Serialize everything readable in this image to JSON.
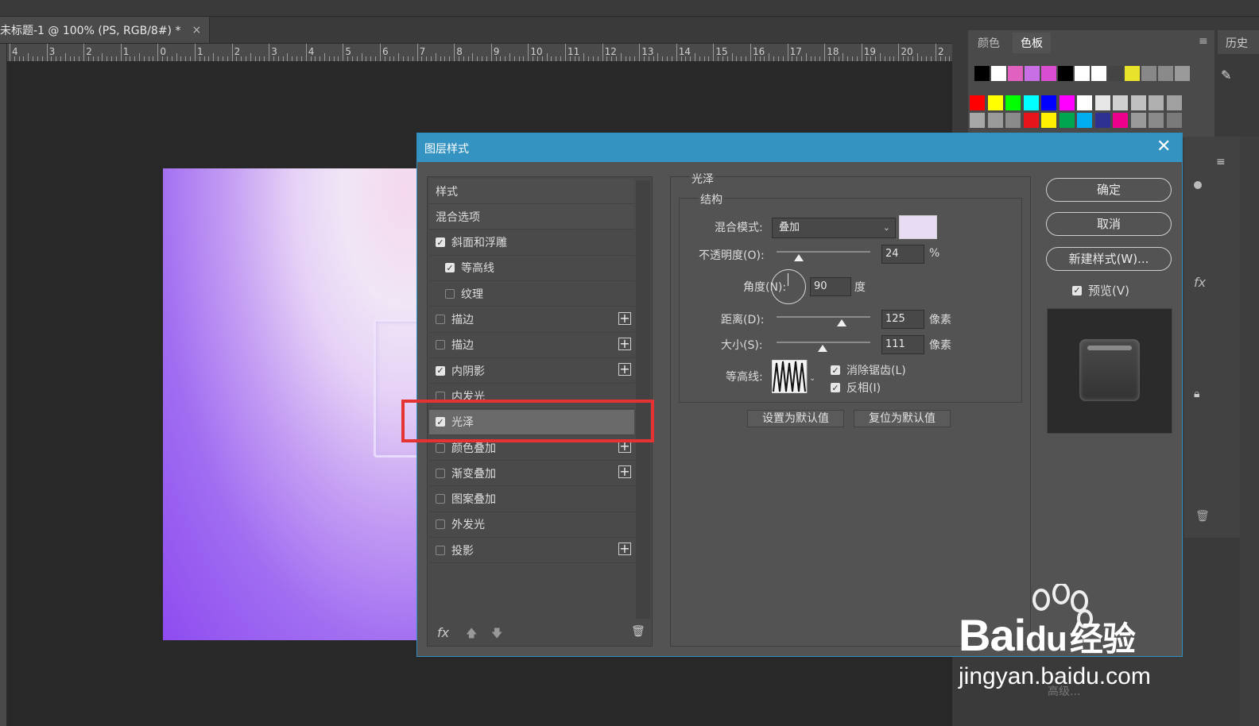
{
  "document": {
    "tab_title": "未标题-1 @ 100% (PS, RGB/8#) *",
    "close_glyph": "×"
  },
  "ruler": {
    "labels": [
      "4",
      "3",
      "2",
      "1",
      "0",
      "1",
      "2",
      "3",
      "4",
      "5",
      "6",
      "7",
      "8",
      "9",
      "10",
      "11",
      "12",
      "13",
      "14",
      "15",
      "16",
      "17",
      "18",
      "19",
      "20",
      "2"
    ]
  },
  "swatches_panel": {
    "tabs": [
      "颜色",
      "色板"
    ],
    "history_tab": "历史",
    "row1": [
      "#000000",
      "#ffffff",
      "#e061c0",
      "#c86fe6",
      "#d94ed1",
      "#000000",
      "#ffffff",
      "#ffffff",
      "#444444",
      "#e8e22a",
      "#888888",
      "#8a8a8a",
      "#9a9a9a"
    ],
    "row2": [
      "#ff0000",
      "#ffff00",
      "#00ff00",
      "#00ffff",
      "#0000ff",
      "#ff00ff",
      "#ffffff",
      "#e6e6e6",
      "#d0d0d0",
      "#c0c0c0",
      "#b0b0b0",
      "#a0a0a0"
    ],
    "row3": [
      "#a7a7a7",
      "#9a9a9a",
      "#8a8a8a",
      "#e8141b",
      "#fff100",
      "#00a650",
      "#00aeef",
      "#2e3192",
      "#ec008c",
      "#9a9a9a",
      "#8a8a8a",
      "#7a7a7a"
    ]
  },
  "dialog": {
    "title": "图层样式",
    "close_glyph": "✕",
    "style_list": [
      {
        "label": "样式",
        "header": true
      },
      {
        "label": "混合选项",
        "header": true
      },
      {
        "label": "斜面和浮雕",
        "checked": true
      },
      {
        "label": "等高线",
        "checked": true,
        "indent": true
      },
      {
        "label": "纹理",
        "checked": false,
        "indent": true
      },
      {
        "label": "描边",
        "checked": false,
        "plus": true
      },
      {
        "label": "描边",
        "checked": false,
        "plus": true
      },
      {
        "label": "内阴影",
        "checked": true,
        "plus": true
      },
      {
        "label": "内发光",
        "checked": false
      },
      {
        "label": "光泽",
        "checked": true,
        "selected": true
      },
      {
        "label": "颜色叠加",
        "checked": false,
        "plus": true
      },
      {
        "label": "渐变叠加",
        "checked": false,
        "plus": true
      },
      {
        "label": "图案叠加",
        "checked": false
      },
      {
        "label": "外发光",
        "checked": false
      },
      {
        "label": "投影",
        "checked": false,
        "plus": true
      }
    ],
    "footer_fx": "fx",
    "section_title": "光泽",
    "subsection_title": "结构",
    "blend_mode_label": "混合模式:",
    "blend_mode_value": "叠加",
    "blend_color": "#e8dcf4",
    "opacity_label": "不透明度(O):",
    "opacity_value": "24",
    "opacity_unit": "%",
    "opacity_pct": 0.24,
    "angle_label": "角度(N):",
    "angle_value": "90",
    "angle_unit": "度",
    "distance_label": "距离(D):",
    "distance_value": "125",
    "distance_unit": "像素",
    "size_label": "大小(S):",
    "size_value": "111",
    "size_unit": "像素",
    "contour_label": "等高线:",
    "antialias_label": "消除锯齿(L)",
    "invert_label": "反相(I)",
    "set_default_label": "设置为默认值",
    "reset_default_label": "复位为默认值",
    "ok_label": "确定",
    "cancel_label": "取消",
    "new_style_label": "新建样式(W)...",
    "preview_label": "预览(V)"
  },
  "right_dock": {
    "fx_label": "fx",
    "advanced_label": "高级..."
  },
  "watermark": {
    "brand": "Bai",
    "brand_du": "du",
    "brand_cn": "经验",
    "url": "jingyan.baidu.com"
  }
}
